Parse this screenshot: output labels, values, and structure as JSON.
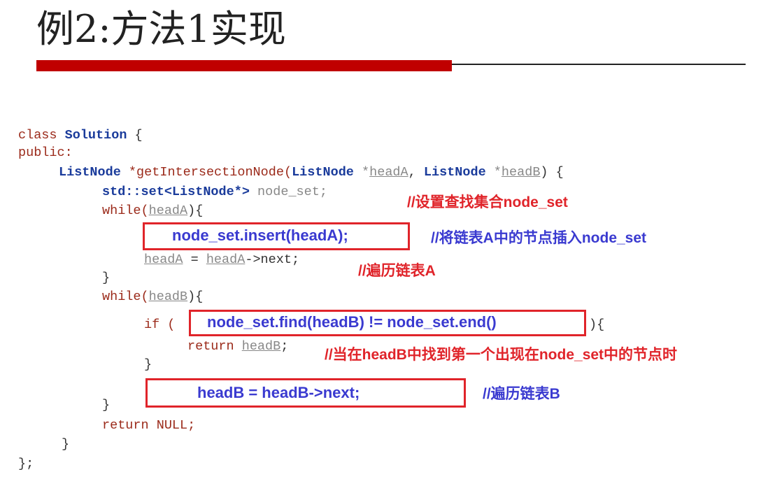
{
  "title": "例2:方法1实现",
  "code": {
    "l1_class": "class",
    "l1_name": "Solution",
    "l1_brace": " {",
    "l2": "public:",
    "l3_type": "ListNode",
    "l3_func": " *getIntersectionNode(",
    "l3_type2": "ListNode",
    "l3_star": " *",
    "l3_argA": "headA",
    "l3_comma": ", ",
    "l3_type3": "ListNode",
    "l3_star2": " *",
    "l3_argB": "headB",
    "l3_end": ") {",
    "l4_std": "std::set<ListNode*>",
    "l4_var": " node_set;",
    "l5_while": "while(",
    "l5_var": "headA",
    "l5_end": "){",
    "l7_varA": "headA",
    "l7_eq": " = ",
    "l7_varA2": "headA",
    "l7_next": "->next;",
    "l8_brace": "}",
    "l9_while": "while(",
    "l9_var": "headB",
    "l9_end": "){",
    "l10_if": "if (",
    "l10_end": "){",
    "l11_return": "return ",
    "l11_var": "headB",
    "l11_semi": ";",
    "l12_brace": "}",
    "l14_brace": "}",
    "l15_return": "return NULL;",
    "l16_brace": "}",
    "l17_end": "};"
  },
  "inserts": {
    "insert_line": "node_set.insert(headA);",
    "find_line": "node_set.find(headB) != node_set.end()",
    "next_line": "headB = headB->next;"
  },
  "comments": {
    "c1": "//设置查找集合node_set",
    "c2": "//将链表A中的节点插入node_set",
    "c3": "//遍历链表A",
    "c4": "//当在headB中找到第一个出现在node_set中的节点时",
    "c5": "//遍历链表B"
  },
  "colors": {
    "accent_red": "#c00000",
    "box_red": "#e0242a",
    "code_blue": "#3a3ad0"
  }
}
